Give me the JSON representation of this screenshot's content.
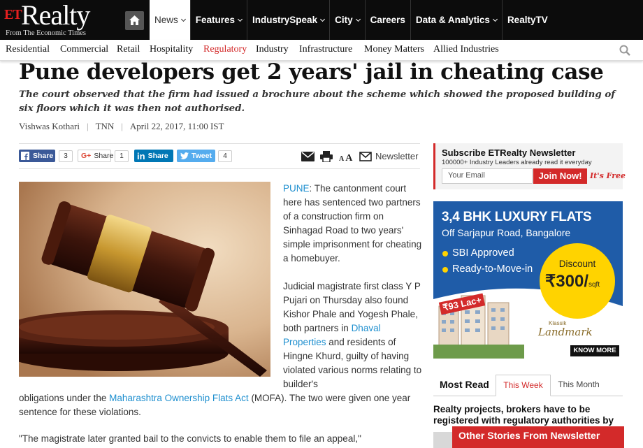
{
  "colors": {
    "brand_red": "#d32a2a",
    "link_blue": "#1e8fcf",
    "header_black": "#0c0c0c"
  },
  "brand": {
    "et": "ET",
    "name": "Realty",
    "tagline": "From The Economic Times"
  },
  "main_nav": [
    {
      "label": "News",
      "dropdown": true,
      "active": true
    },
    {
      "label": "Features",
      "dropdown": true
    },
    {
      "label": "IndustrySpeak",
      "dropdown": true
    },
    {
      "label": "City",
      "dropdown": true
    },
    {
      "label": "Careers",
      "dropdown": false
    },
    {
      "label": "Data & Analytics",
      "dropdown": true
    },
    {
      "label": "RealtyTV",
      "dropdown": false
    }
  ],
  "sub_nav": [
    "Residential",
    "Commercial",
    "Retail",
    "Hospitality",
    "Regulatory",
    "Industry",
    "Infrastructure",
    "Money Matters",
    "Allied Industries"
  ],
  "sub_nav_active": "Regulatory",
  "article": {
    "headline": "Pune developers get 2 years' jail in cheating case",
    "synopsis": "The court observed that the firm had issued a brochure about the scheme which showed the proposed building of six floors which it was then not authorised.",
    "author": "Vishwas Kothari",
    "source": "TNN",
    "date": "April 22, 2017, 11:00 IST",
    "dateline": "PUNE",
    "p1": ": The cantonment court here has sentenced two partners of a construction firm on Sinhagad Road to two years' simple imprisonment for cheating a homebuyer.",
    "p2_a": "Judicial magistrate first class Y P Pujari on Thursday also found Kishor Phale and Yogesh Phale, both partners in ",
    "p2_link1": "Dhaval Properties",
    "p2_b": " and residents of Hingne Khurd, guilty of having violated various norms relating to builder's",
    "p2_c": "obligations under the ",
    "p2_link2": "Maharashtra Ownership Flats Act",
    "p2_d": " (MOFA). The two were given one year sentence for these violations.",
    "p3": "\"The magistrate later granted bail to the convicts to enable them to file an appeal,\""
  },
  "share": {
    "facebook_label": "Share",
    "facebook_count": "3",
    "gplus_label": "Share",
    "gplus_glyph": "G+",
    "gplus_count": "1",
    "linkedin_label": "Share",
    "linkedin_glyph": "in",
    "twitter_label": "Tweet",
    "twitter_count": "4",
    "font_small": "A",
    "font_big": "A",
    "newsletter_label": "Newsletter"
  },
  "newsletter_box": {
    "title": "Subscribe ETRealty Newsletter",
    "subtitle": "100000+ Industry Leaders already read it everyday",
    "placeholder": "Your Email",
    "button": "Join Now!",
    "free": "It's Free"
  },
  "ad": {
    "title": "3,4 BHK LUXURY FLATS",
    "subtitle": "Off Sarjapur Road, Bangalore",
    "bullet1": "SBI Approved",
    "bullet2": "Ready-to-Move-in",
    "discount_label": "Discount",
    "discount_value": "₹300/",
    "discount_unit": "sqft",
    "price_tag": "₹93 Lac+",
    "brand_small": "Klassik",
    "brand": "Landmark",
    "cta": "KNOW MORE"
  },
  "most_read": {
    "title": "Most Read",
    "tab_active": "This Week",
    "tab_other": "This Month",
    "first_item": "Realty projects, brokers have to be registered with regulatory authorities by"
  },
  "other_stories": "Other Stories From Newsletter"
}
